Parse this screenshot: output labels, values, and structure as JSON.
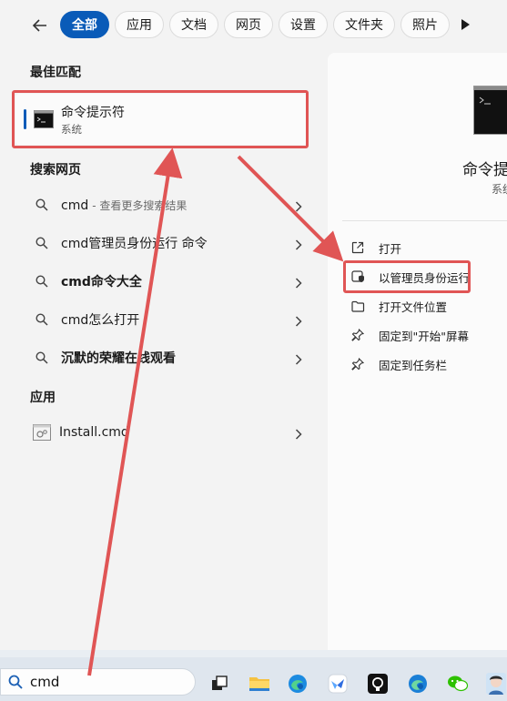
{
  "filters": {
    "items": [
      "全部",
      "应用",
      "文档",
      "网页",
      "设置",
      "文件夹",
      "照片"
    ],
    "active_index": 0
  },
  "best_match": {
    "heading": "最佳匹配",
    "title": "命令提示符",
    "subtitle": "系统"
  },
  "web_search": {
    "heading": "搜索网页",
    "items": [
      {
        "label": "cmd",
        "suffix": "- 查看更多搜索结果",
        "bold": false
      },
      {
        "label": "cmd管理员身份运行 命令",
        "suffix": "",
        "bold": false
      },
      {
        "label": "cmd命令大全",
        "suffix": "",
        "bold": true
      },
      {
        "label": "cmd怎么打开",
        "suffix": "",
        "bold": false
      },
      {
        "label": "沉默的荣耀在线观看",
        "suffix": "",
        "bold": true
      }
    ]
  },
  "apps": {
    "heading": "应用",
    "items": [
      {
        "label": "Install.cmd"
      }
    ]
  },
  "preview": {
    "name": "命令提示符",
    "type": "系统",
    "actions": [
      {
        "label": "打开",
        "icon": "open-external-icon"
      },
      {
        "label": "以管理员身份运行",
        "icon": "shield-admin-icon"
      },
      {
        "label": "打开文件位置",
        "icon": "folder-icon"
      },
      {
        "label": "固定到\"开始\"屏幕",
        "icon": "pin-icon"
      },
      {
        "label": "固定到任务栏",
        "icon": "pin-icon"
      }
    ]
  },
  "taskbar": {
    "search_value": "cmd",
    "apps": [
      "task-view-icon",
      "file-explorer-icon",
      "edge-icon",
      "feishu-icon",
      "github-icon",
      "edge-icon",
      "wechat-icon",
      "avatar-icon"
    ]
  },
  "colors": {
    "accent": "#0a5bb8",
    "annotation_red": "#e05555"
  }
}
